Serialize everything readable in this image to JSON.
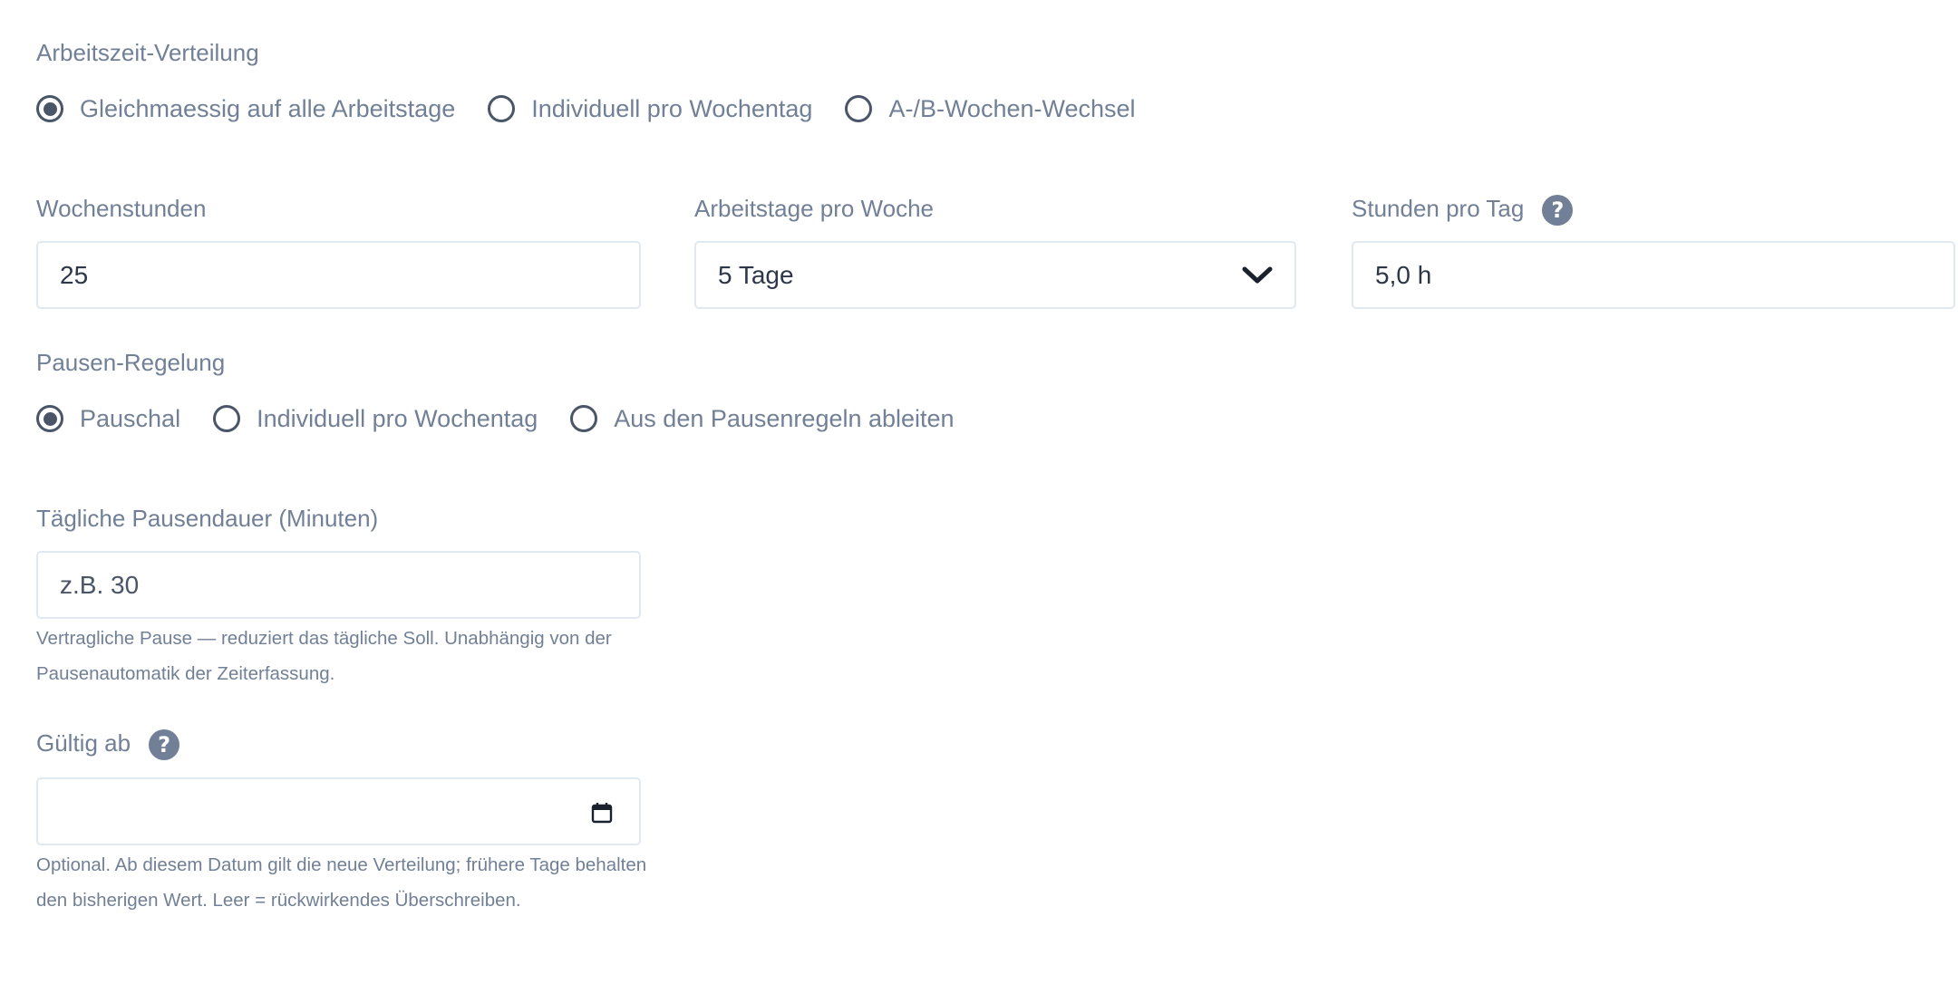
{
  "distribution": {
    "label": "Arbeitszeit-Verteilung",
    "options": [
      {
        "label": "Gleichmaessig auf alle Arbeitstage",
        "checked": true
      },
      {
        "label": "Individuell pro Wochentag",
        "checked": false
      },
      {
        "label": "A-/B-Wochen-Wechsel",
        "checked": false
      }
    ]
  },
  "weekly_hours": {
    "label": "Wochenstunden",
    "value": "25"
  },
  "workdays": {
    "label": "Arbeitstage pro Woche",
    "value": "5 Tage",
    "icon": "chevron-down-icon"
  },
  "hours_per_day": {
    "label": "Stunden pro Tag",
    "value": "5,0 h",
    "help_icon": "?"
  },
  "break_rule": {
    "label": "Pausen-Regelung",
    "options": [
      {
        "label": "Pauschal",
        "checked": true
      },
      {
        "label": "Individuell pro Wochentag",
        "checked": false
      },
      {
        "label": "Aus den Pausenregeln ableiten",
        "checked": false
      }
    ]
  },
  "daily_break": {
    "label": "Tägliche Pausendauer (Minuten)",
    "placeholder": "z.B. 30",
    "value": "",
    "hint": "Vertragliche Pause — reduziert das tägliche Soll. Unabhängig von der Pausenautomatik der Zeiterfassung."
  },
  "valid_from": {
    "label": "Gültig ab",
    "help_icon": "?",
    "value": "",
    "icon": "calendar-icon",
    "hint": "Optional. Ab diesem Datum gilt die neue Verteilung; frühere Tage behalten den bisherigen Wert. Leer = rückwirkendes Überschreiben."
  }
}
